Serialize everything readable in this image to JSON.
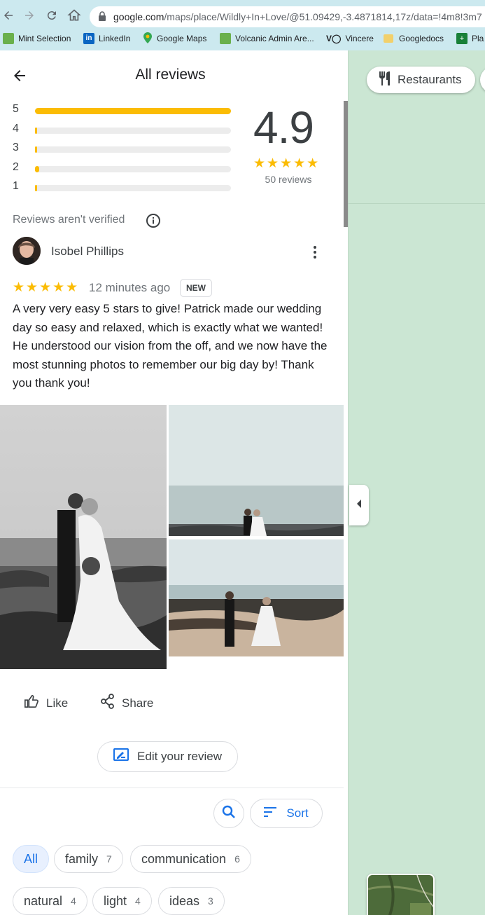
{
  "browser": {
    "url_host": "google.com",
    "url_path": "/maps/place/Wildly+In+Love/@51.09429,-3.4871814,17z/data=!4m8!3m7",
    "bookmarks": [
      {
        "label": "Mint Selection",
        "icon": "mint-icon"
      },
      {
        "label": "LinkedIn",
        "icon": "linkedin-icon"
      },
      {
        "label": "Google Maps",
        "icon": "maps-pin-icon"
      },
      {
        "label": "Volcanic Admin Are...",
        "icon": "volcanic-icon"
      },
      {
        "label": "Vincere",
        "icon": "vincere-icon"
      },
      {
        "label": "Googledocs",
        "icon": "folder-icon"
      },
      {
        "label": "Pla",
        "icon": "sheets-icon"
      }
    ]
  },
  "panel": {
    "title": "All reviews",
    "distribution": [
      {
        "stars": "5",
        "fraction": 1.0
      },
      {
        "stars": "4",
        "fraction": 0.0
      },
      {
        "stars": "3",
        "fraction": 0.0
      },
      {
        "stars": "2",
        "fraction": 0.02
      },
      {
        "stars": "1",
        "fraction": 0.0
      }
    ],
    "rating": "4.9",
    "rating_stars": "★★★★★",
    "review_count": "50 reviews",
    "verified_note": "Reviews aren't verified"
  },
  "review": {
    "author": "Isobel Phillips",
    "stars": "★★★★★",
    "time": "12 minutes ago",
    "badge": "NEW",
    "text": "A very very easy 5 stars to give! Patrick made our wedding day so easy and relaxed, which is exactly what we wanted! He understood our vision from the off, and we now have the most stunning photos to remember our big day by! Thank you thank you!",
    "like_label": "Like",
    "share_label": "Share",
    "edit_label": "Edit your review"
  },
  "filters": {
    "sort_label": "Sort",
    "chips": [
      {
        "label": "All",
        "count": ""
      },
      {
        "label": "family",
        "count": "7"
      },
      {
        "label": "communication",
        "count": "6"
      },
      {
        "label": "natural",
        "count": "4"
      },
      {
        "label": "light",
        "count": "4"
      },
      {
        "label": "ideas",
        "count": "3"
      }
    ]
  },
  "map": {
    "restaurants_label": "Restaurants"
  },
  "colors": {
    "star": "#fbbc04",
    "accent": "#1a73e8",
    "map_bg": "#cbe6d3",
    "browser_bar": "#cce9ef"
  }
}
